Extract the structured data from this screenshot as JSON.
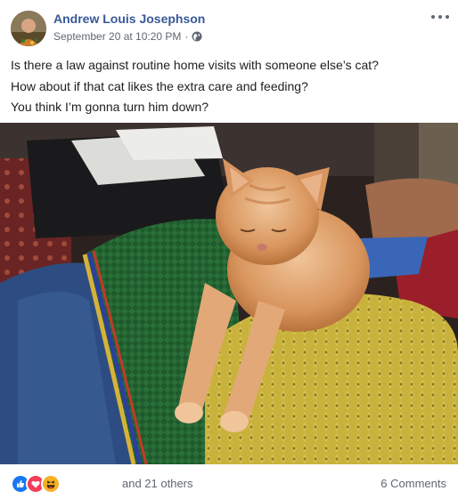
{
  "post": {
    "author": "Andrew Louis Josephson",
    "date": "September 20 at 10:20 PM",
    "separator": "·",
    "privacy_icon": "globe-icon",
    "more_icon": "more-options-icon",
    "lines": [
      "Is there a law against routine home visits with someone else’s cat?",
      "How about if that cat likes the extra care and feeding?",
      "You think I’m gonna turn him down?"
    ],
    "photo_icon": "cat-photo"
  },
  "footer": {
    "reactions": [
      "like-reaction-icon",
      "love-reaction-icon",
      "haha-reaction-icon"
    ],
    "reaction_text": "and 21 others",
    "comments": "6 Comments"
  },
  "colors": {
    "link_blue": "#385898",
    "meta_gray": "#606770",
    "like_blue": "#1877f2",
    "love_red": "#f33e58",
    "haha_yellow": "#f7b125"
  }
}
